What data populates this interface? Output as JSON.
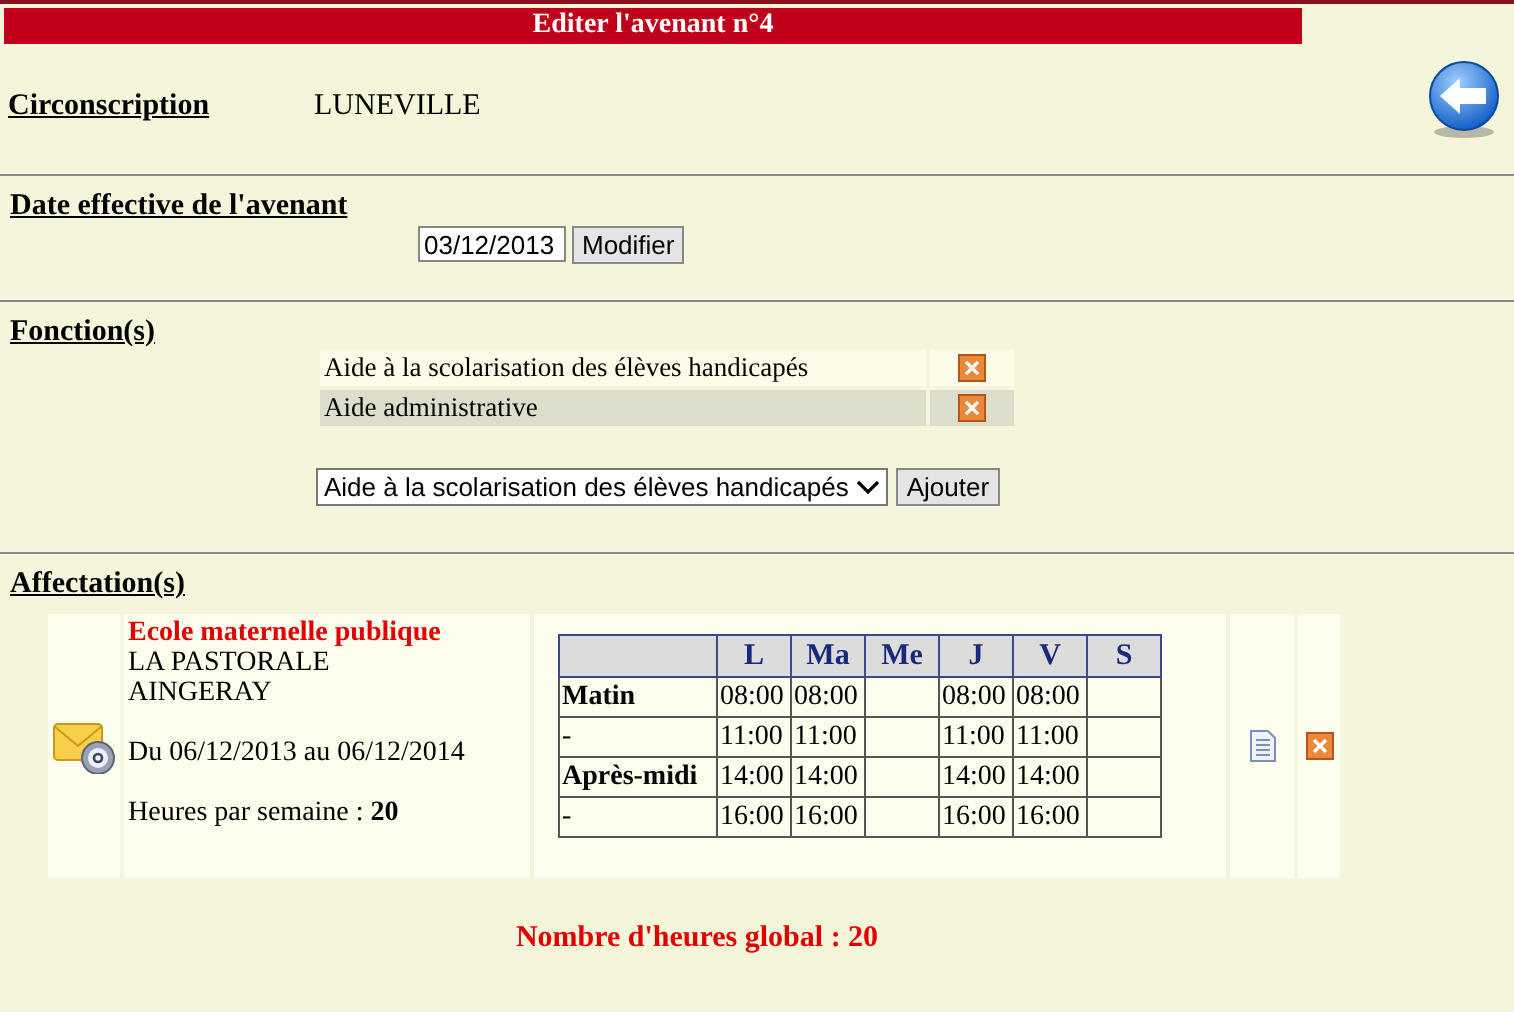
{
  "title": "Editer l'avenant n°4",
  "circonscription": {
    "label": "Circonscription",
    "value": "LUNEVILLE"
  },
  "date_section": {
    "heading": "Date effective de l'avenant",
    "date_value": "03/12/2013",
    "button": "Modifier"
  },
  "functions_section": {
    "heading": "Fonction(s)",
    "items": [
      {
        "label": "Aide à la scolarisation des élèves handicapés"
      },
      {
        "label": "Aide administrative"
      }
    ],
    "select_value": "Aide à la scolarisation des élèves handicapés",
    "button": "Ajouter"
  },
  "assignments_section": {
    "heading": "Affectation(s)",
    "items": [
      {
        "school_type": "Ecole maternelle publique",
        "school_name": "LA PASTORALE",
        "town": "AINGERAY",
        "period": "Du 06/12/2013 au 06/12/2014",
        "hours_label": "Heures par semaine : ",
        "hours_value": "20",
        "schedule": {
          "columns": [
            "L",
            "Ma",
            "Me",
            "J",
            "V",
            "S"
          ],
          "rows": [
            {
              "label": "Matin",
              "bold": true,
              "cells": [
                "08:00",
                "08:00",
                "",
                "08:00",
                "08:00",
                ""
              ]
            },
            {
              "label": "-",
              "bold": false,
              "cells": [
                "11:00",
                "11:00",
                "",
                "11:00",
                "11:00",
                ""
              ]
            },
            {
              "label": "Après-midi",
              "bold": true,
              "cells": [
                "14:00",
                "14:00",
                "",
                "14:00",
                "14:00",
                ""
              ]
            },
            {
              "label": "-",
              "bold": false,
              "cells": [
                "16:00",
                "16:00",
                "",
                "16:00",
                "16:00",
                ""
              ]
            }
          ]
        }
      }
    ]
  },
  "total": "Nombre d'heures global : 20"
}
